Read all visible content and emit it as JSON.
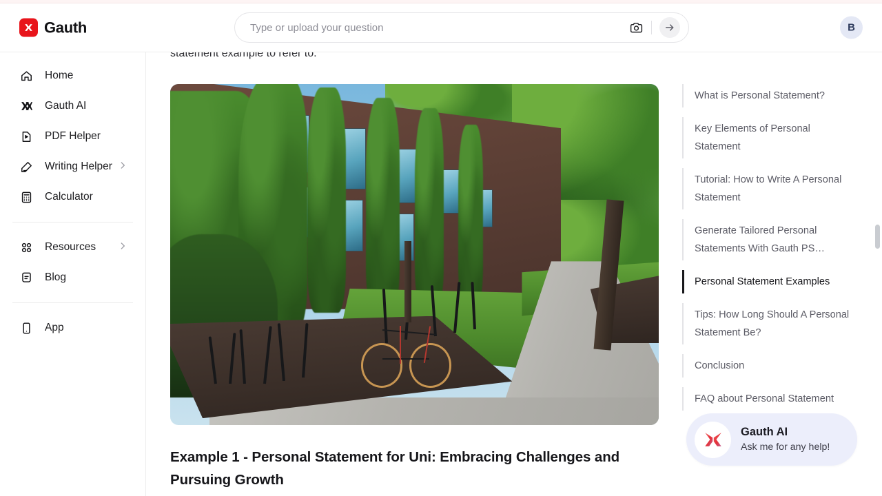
{
  "header": {
    "brand_name": "Gauth",
    "brand_icon": "gauth-x-logo-icon",
    "search": {
      "placeholder": "Type or upload your question",
      "value": "",
      "camera_icon": "camera-icon",
      "submit_icon": "arrow-right-icon"
    },
    "avatar_initial": "B"
  },
  "sidebar": {
    "items": [
      {
        "label": "Home",
        "icon": "home-icon",
        "chevron": false
      },
      {
        "label": "Gauth AI",
        "icon": "gauth-ai-icon",
        "chevron": false
      },
      {
        "label": "PDF Helper",
        "icon": "pdf-file-icon",
        "chevron": false
      },
      {
        "label": "Writing Helper",
        "icon": "pen-icon",
        "chevron": true
      },
      {
        "label": "Calculator",
        "icon": "calculator-icon",
        "chevron": false
      }
    ],
    "group2": [
      {
        "label": "Resources",
        "icon": "grid-icon",
        "chevron": true
      },
      {
        "label": "Blog",
        "icon": "document-icon",
        "chevron": false
      }
    ],
    "group3": [
      {
        "label": "App",
        "icon": "mobile-phone-icon",
        "chevron": false
      }
    ]
  },
  "main": {
    "cut_off_paragraph": "statement example to refer to.",
    "figure_alt": "Ivy-covered brick university building with bike racks, a bicycle, green lawn and a concrete sidewalk",
    "article_heading": "Example 1 - Personal Statement for Uni: Embracing Challenges and Pursuing Growth"
  },
  "toc": {
    "items": [
      {
        "label": "What is Personal Statement?",
        "active": false
      },
      {
        "label": "Key Elements of Personal Statement",
        "active": false
      },
      {
        "label": "Tutorial: How to Write A Personal Statement",
        "active": false
      },
      {
        "label": "Generate Tailored Personal Statements With Gauth PS…",
        "active": false
      },
      {
        "label": "Personal Statement Examples",
        "active": true
      },
      {
        "label": "Tips: How Long Should A Personal Statement Be?",
        "active": false
      },
      {
        "label": "Conclusion",
        "active": false
      },
      {
        "label": "FAQ about Personal Statement",
        "active": false
      }
    ]
  },
  "ai_widget": {
    "title": "Gauth AI",
    "subtitle": "Ask me for any help!",
    "logo_icon": "gauth-x-gradient-icon"
  },
  "colors": {
    "brand_red": "#e8141b",
    "accent_active": "#18181b",
    "widget_bg": "#eceefb",
    "avatar_bg": "#e4e8f5"
  }
}
